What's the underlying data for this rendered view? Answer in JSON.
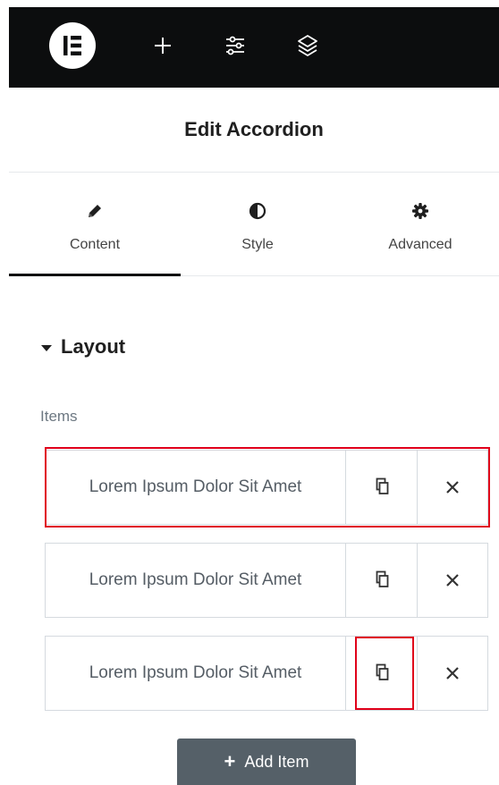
{
  "topbar": {
    "logo_icon": "elementor-logo-icon",
    "add_icon": "plus-icon",
    "settings_icon": "sliders-icon",
    "navigator_icon": "layers-icon",
    "background": "#0c0d0e"
  },
  "panel": {
    "title": "Edit Accordion"
  },
  "tabs": [
    {
      "label": "Content",
      "icon": "pencil-icon",
      "active": true
    },
    {
      "label": "Style",
      "icon": "half-circle-icon",
      "active": false
    },
    {
      "label": "Advanced",
      "icon": "gear-icon",
      "active": false
    }
  ],
  "section": {
    "title": "Layout",
    "toggle_icon": "caret-down-icon"
  },
  "repeater": {
    "label": "Items",
    "items": [
      {
        "title": "Lorem Ipsum Dolor Sit Amet"
      },
      {
        "title": "Lorem Ipsum Dolor Sit Amet"
      },
      {
        "title": "Lorem Ipsum Dolor Sit Amet"
      }
    ],
    "duplicate_icon": "duplicate-icon",
    "remove_icon": "close-icon",
    "add_button_label": "Add Item"
  },
  "colors": {
    "highlight": "#e0001a",
    "button": "#556068"
  }
}
